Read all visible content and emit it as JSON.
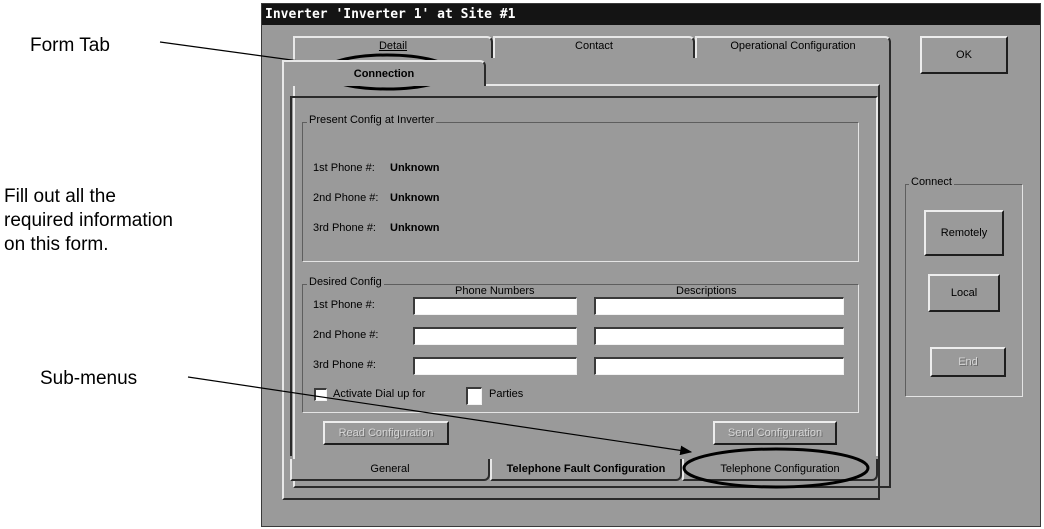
{
  "callouts": {
    "form_tab": "Form Tab",
    "fill_out": [
      "Fill out all the",
      "required information",
      "on this form."
    ],
    "sub_menus": "Sub-menus"
  },
  "window": {
    "title": "Inverter 'Inverter 1' at Site #1",
    "top_tabs": [
      "Detail",
      "Contact",
      "Operational Configuration"
    ],
    "active_tab": "Connection"
  },
  "present_config": {
    "legend": "Present Config at Inverter",
    "rows": [
      {
        "label": "1st Phone #:",
        "value": "Unknown"
      },
      {
        "label": "2nd Phone #:",
        "value": "Unknown"
      },
      {
        "label": "3rd Phone #:",
        "value": "Unknown"
      }
    ]
  },
  "desired_config": {
    "legend": "Desired Config",
    "col_phone": "Phone Numbers",
    "col_desc": "Descriptions",
    "rows": [
      {
        "label": "1st Phone #:",
        "phone": "",
        "desc": ""
      },
      {
        "label": "2nd Phone #:",
        "phone": "",
        "desc": ""
      },
      {
        "label": "3rd Phone #:",
        "phone": "",
        "desc": ""
      }
    ],
    "activate_label": "Activate Dial up for",
    "activate_count": "",
    "parties_label": "Parties"
  },
  "buttons": {
    "read": "Read Configuration",
    "send": "Send Configuration",
    "ok": "OK",
    "remotely": "Remotely",
    "local": "Local",
    "end": "End"
  },
  "connect_group": {
    "legend": "Connect"
  },
  "bottom_tabs": [
    "General",
    "Telephone Fault Configuration",
    "Telephone Configuration"
  ]
}
